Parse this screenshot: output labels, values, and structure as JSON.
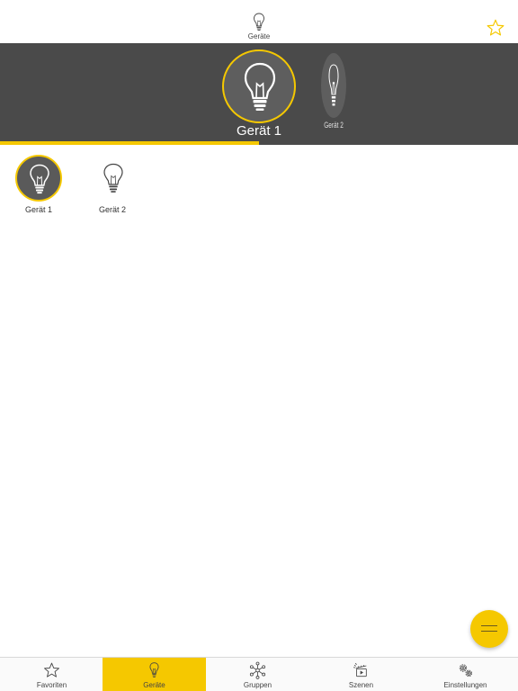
{
  "header": {
    "title": "Geräte",
    "title_icon": "bulb-icon",
    "favorite_icon": "star-outline-icon"
  },
  "carousel": {
    "current": {
      "label": "Gerät 1",
      "icon": "bulb-icon"
    },
    "next": {
      "label": "Gerät 2",
      "icon": "bulb-icon"
    },
    "progress": 0.5
  },
  "devices": [
    {
      "label": "Gerät 1",
      "icon": "bulb-icon",
      "selected": true
    },
    {
      "label": "Gerät 2",
      "icon": "bulb-icon",
      "selected": false
    }
  ],
  "fab": {
    "icon": "menu-lines-icon"
  },
  "tabs": [
    {
      "label": "Favoriten",
      "icon": "star-icon",
      "selected": false
    },
    {
      "label": "Geräte",
      "icon": "bulb-icon",
      "selected": true
    },
    {
      "label": "Gruppen",
      "icon": "network-icon",
      "selected": false
    },
    {
      "label": "Szenen",
      "icon": "scene-clapper-icon",
      "selected": false
    },
    {
      "label": "Einstellungen",
      "icon": "gears-icon",
      "selected": false
    }
  ],
  "colors": {
    "accent": "#f5c800",
    "header_dark": "#4a4a4a",
    "circle_dark": "#5a5a5a"
  }
}
